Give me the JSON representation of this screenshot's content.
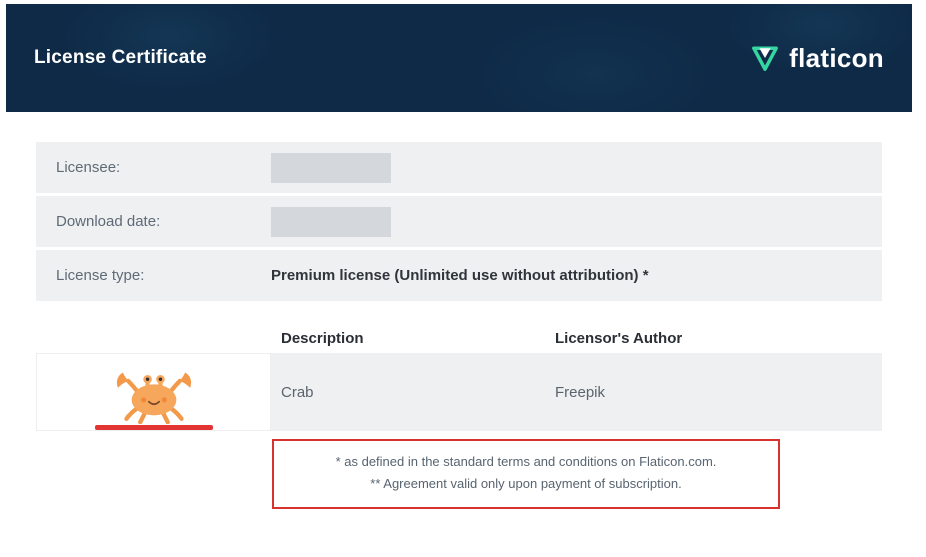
{
  "header": {
    "title": "License Certificate",
    "brand_name": "flaticon"
  },
  "info": {
    "licensee_label": "Licensee:",
    "licensee_value": "",
    "download_date_label": "Download date:",
    "download_date_value": "",
    "license_type_label": "License type:",
    "license_type_value": "Premium license (Unlimited use without attribution) *"
  },
  "columns": {
    "description": "Description",
    "author": "Licensor's Author"
  },
  "asset": {
    "description": "Crab",
    "author": "Freepik",
    "icon_name": "crab-icon"
  },
  "footnotes": {
    "line1": "* as defined in the standard terms and conditions on Flaticon.com.",
    "line2": "** Agreement valid only upon payment of subscription."
  }
}
